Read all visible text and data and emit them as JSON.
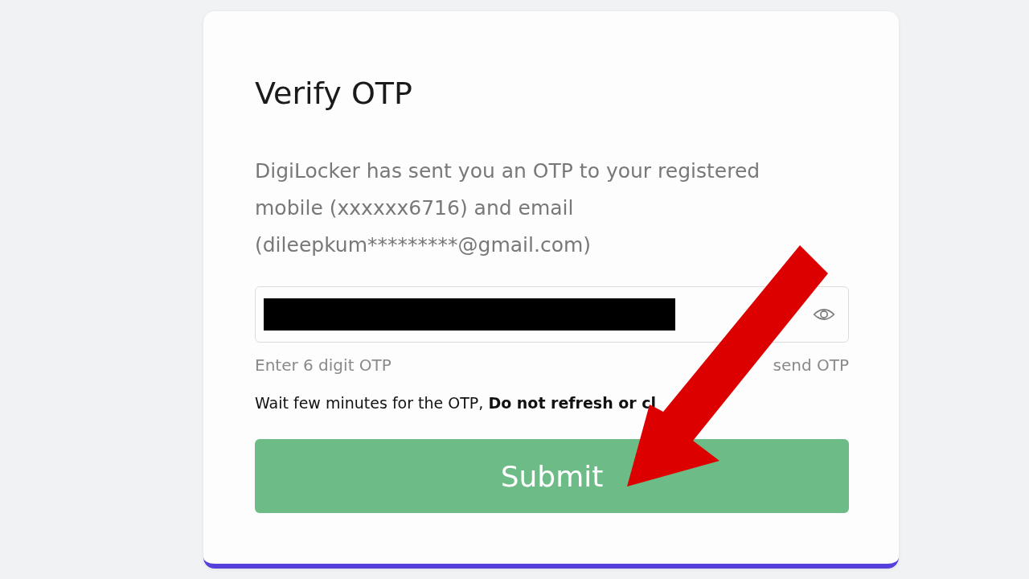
{
  "title": "Verify OTP",
  "message": "DigiLocker has sent you an OTP to your registered mobile (xxxxxx6716) and email (dileepkum*********@gmail.com)",
  "otp_field": {
    "redacted": true
  },
  "hint": "Enter 6 digit OTP",
  "resend": "send OTP",
  "notice": "Wait few minutes for the OTP, **Do not refresh or cl**",
  "submit": "Submit"
}
